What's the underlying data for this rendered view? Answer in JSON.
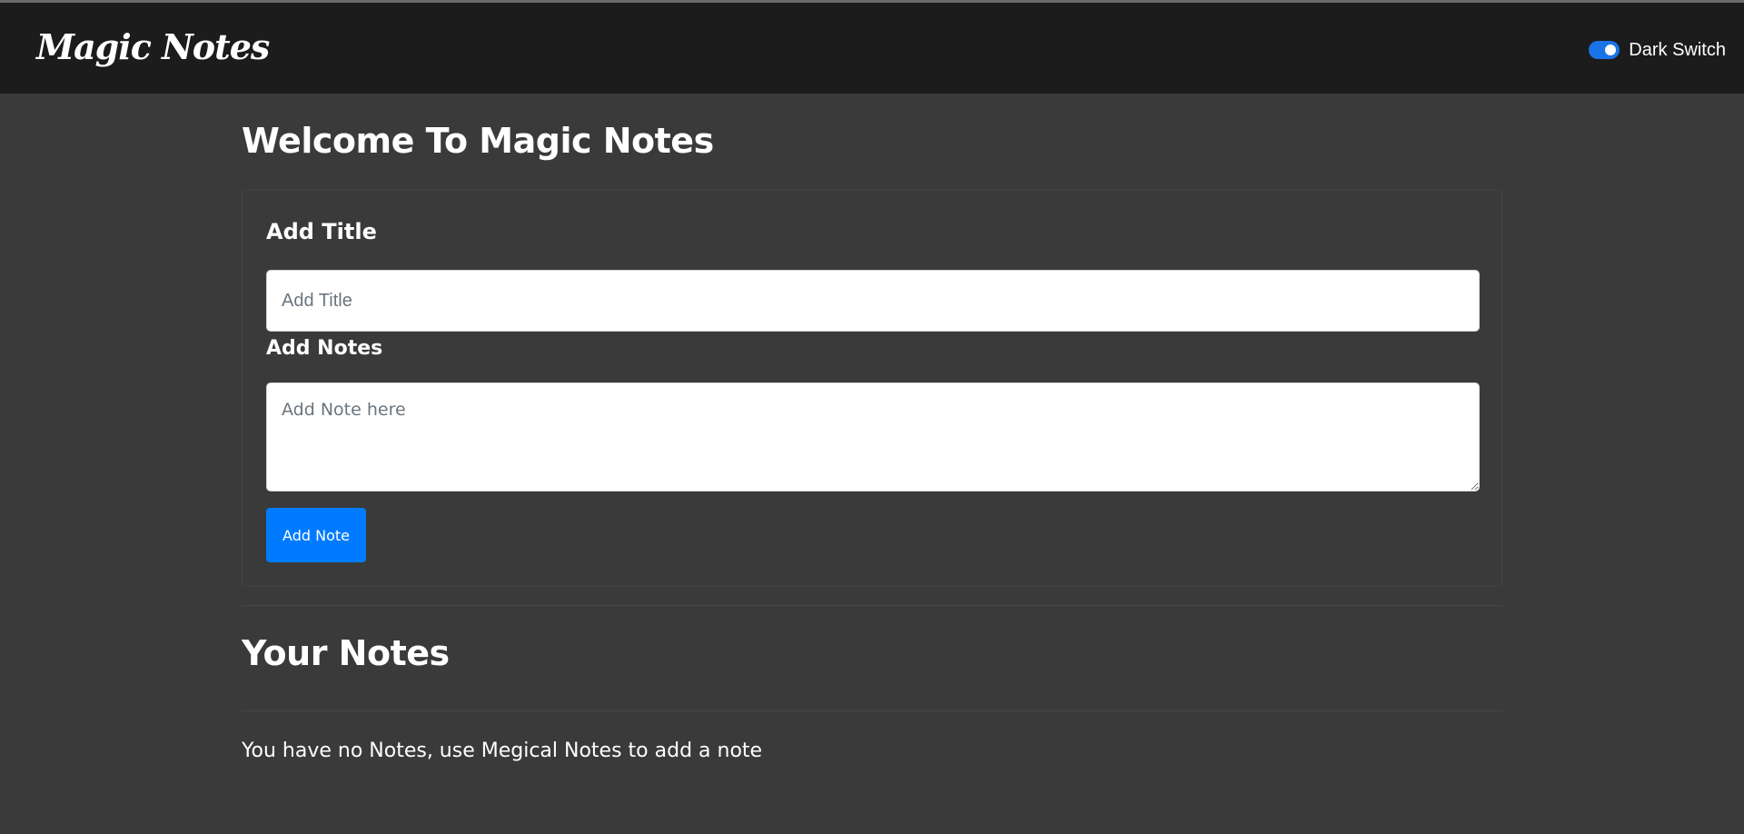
{
  "navbar": {
    "brand": "Magic Notes",
    "dark_switch": {
      "label": "Dark Switch",
      "checked": true,
      "accent": "#1a73e8"
    }
  },
  "main": {
    "title": "Welcome To Magic Notes",
    "form": {
      "title_label": "Add Title",
      "title_placeholder": "Add Title",
      "title_value": "",
      "notes_label": "Add Notes",
      "notes_placeholder": "Add Note here",
      "notes_value": "",
      "add_button_label": "Add Note",
      "button_color": "#007bff"
    },
    "notes_section": {
      "title": "Your Notes",
      "empty_message": "You have no Notes, use Megical Notes to add a note"
    }
  },
  "colors": {
    "background": "#3a3a3a",
    "navbar": "#1c1c1c"
  }
}
